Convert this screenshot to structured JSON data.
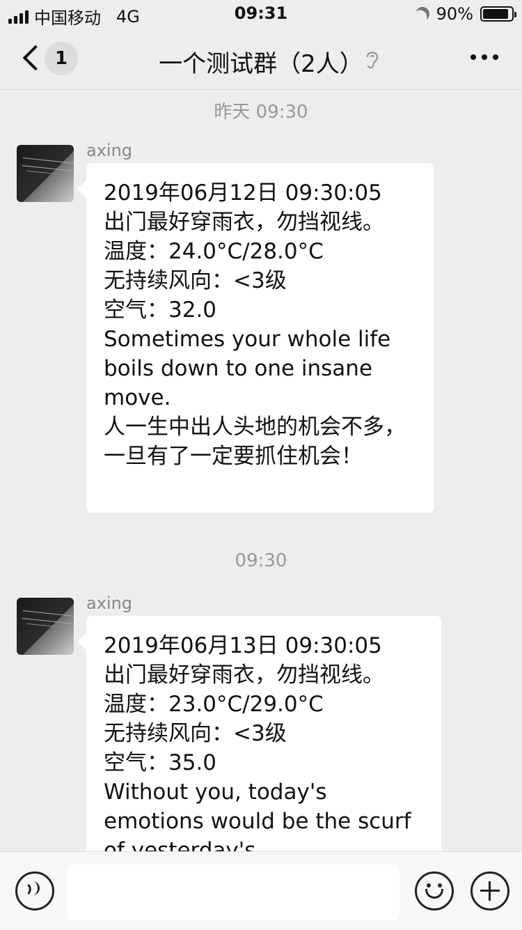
{
  "status_bar": {
    "carrier": "中国移动",
    "network": "4G",
    "time": "09:31",
    "battery_percent": "90%",
    "battery_level": 0.9
  },
  "nav": {
    "back_badge": "1",
    "title": "一个测试群（2人）"
  },
  "chat": {
    "timestamps": [
      "昨天 09:30",
      "09:30"
    ],
    "messages": [
      {
        "sender": "axing",
        "text": "2019年06月12日 09:30:05\n出门最好穿雨衣，勿挡视线。\n温度：24.0°C/28.0°C\n无持续风向：<3级\n空气：32.0\nSometimes your whole life boils down to one insane move.\n人一生中出人头地的机会不多，一旦有了一定要抓住机会！"
      },
      {
        "sender": "axing",
        "text": "2019年06月13日 09:30:05\n出门最好穿雨衣，勿挡视线。\n温度：23.0°C/29.0°C\n无持续风向：<3级\n空气：35.0\nWithout you, today's emotions would be the scurf of yesterday's"
      }
    ]
  },
  "input_bar": {
    "placeholder": ""
  }
}
